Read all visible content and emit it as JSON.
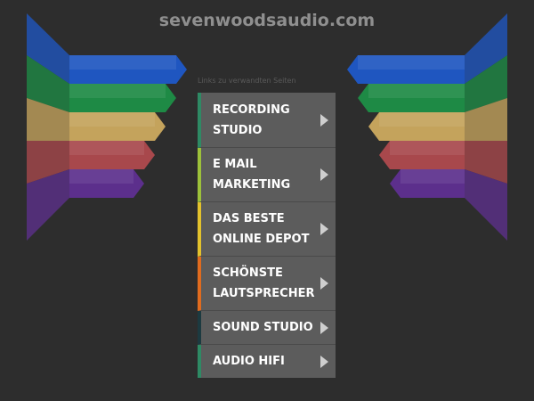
{
  "site": {
    "domain": "sevenwoodsaudio.com",
    "related_links_label": "Links zu verwandten Seiten"
  },
  "menu": {
    "items": [
      {
        "label": "RECORDING STUDIO",
        "color": "#2e8a64"
      },
      {
        "label": "E MAIL MARKETING",
        "color": "#9dc13a"
      },
      {
        "label": "DAS BESTE ONLINE DEPOT",
        "color": "#e3c22c"
      },
      {
        "label": "SCHÖNSTE LAUTSPRECHER",
        "color": "#e06b1e"
      },
      {
        "label": "SOUND STUDIO",
        "color": "#1c3a40"
      },
      {
        "label": "AUDIO HIFI",
        "color": "#2e8a64"
      }
    ]
  },
  "decoration": {
    "band_colors": [
      "#1f56c0",
      "#1e8a45",
      "#c4a35c",
      "#a8484c",
      "#5c2f8c"
    ]
  }
}
